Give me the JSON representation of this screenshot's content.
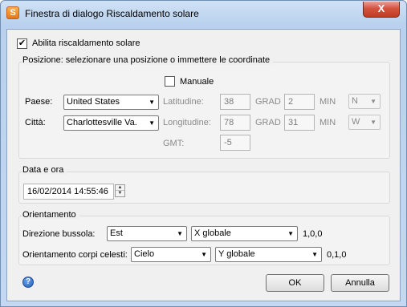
{
  "window": {
    "title": "Finestra di dialogo Riscaldamento solare",
    "close_glyph": "X"
  },
  "enable": {
    "label": "Abilita riscaldamento solare",
    "checked": true
  },
  "position": {
    "title": "Posizione: selezionare una posizione o immettere le coordinate",
    "manual_label": "Manuale",
    "manual_checked": false,
    "country_label": "Paese:",
    "country_value": "United States",
    "city_label": "Città:",
    "city_value": "Charlottesville Va.",
    "latitude_label": "Latitudine:",
    "latitude_value": "38",
    "longitude_label": "Longitudine:",
    "longitude_value": "78",
    "grad_label": "GRAD",
    "lat_min_value": "2",
    "lon_min_value": "31",
    "min_label": "MIN",
    "ns_value": "N",
    "ew_value": "W",
    "gmt_label": "GMT:",
    "gmt_value": "-5"
  },
  "datetime": {
    "title": "Data e ora",
    "value": "16/02/2014 14:55:46"
  },
  "orientation": {
    "title": "Orientamento",
    "compass_label": "Direzione bussola:",
    "compass_value": "Est",
    "compass_axis": "X globale",
    "compass_vector": "1,0,0",
    "celestial_label": "Orientamento corpi celesti:",
    "celestial_value": "Cielo",
    "celestial_axis": "Y globale",
    "celestial_vector": "0,1,0"
  },
  "buttons": {
    "ok": "OK",
    "cancel": "Annulla",
    "help_glyph": "?"
  },
  "colors": {
    "close_button": "#c23a23",
    "titlebar": "#b9d1ee",
    "help_icon": "#1f5fb8"
  }
}
